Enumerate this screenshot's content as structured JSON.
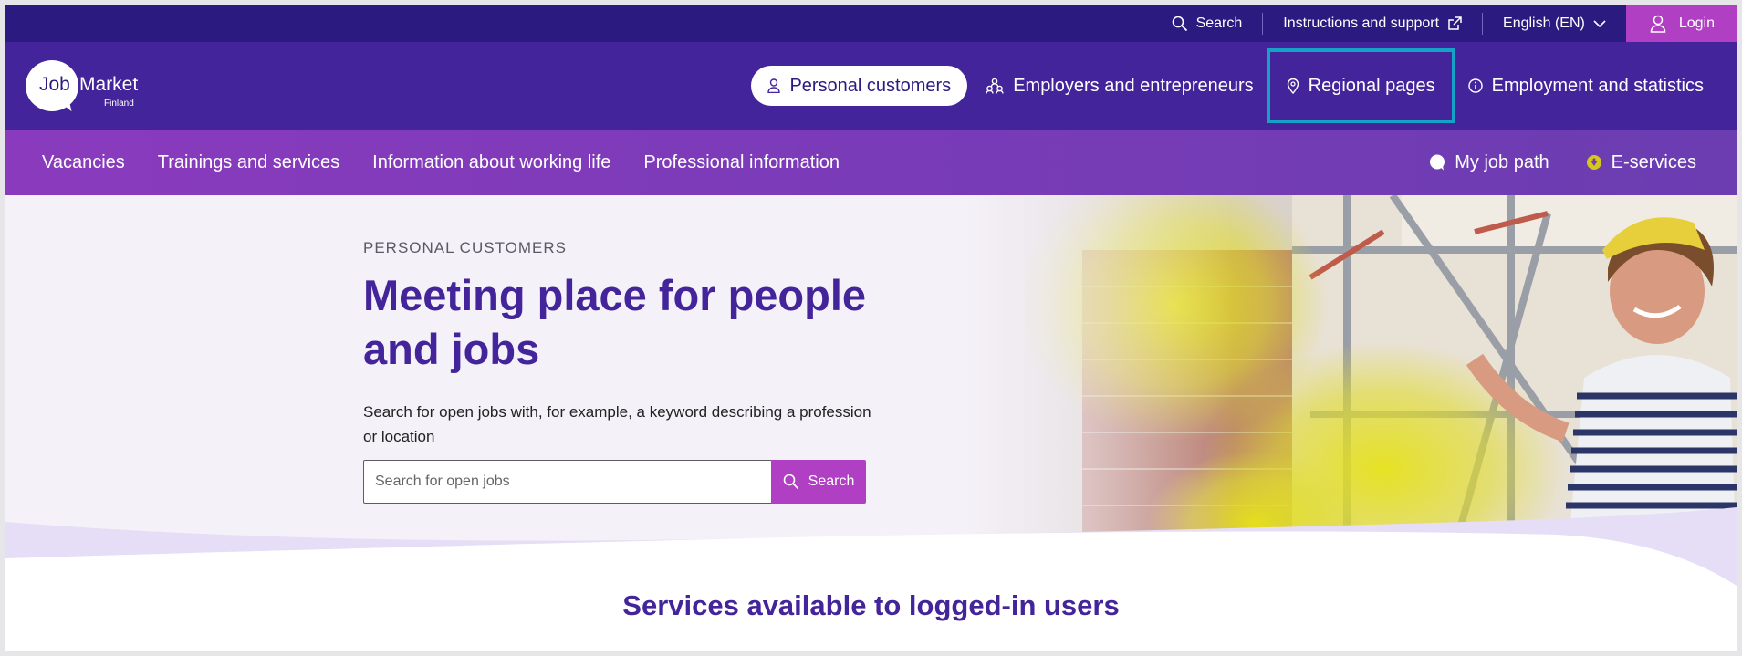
{
  "utility": {
    "search_label": "Search",
    "support_label": "Instructions and support",
    "language_label": "English (EN)",
    "login_label": "Login"
  },
  "logo": {
    "job": "Job",
    "market": "Market",
    "finland": "Finland"
  },
  "audience_nav": [
    {
      "label": "Personal customers",
      "icon": "person-icon",
      "active": true
    },
    {
      "label": "Employers and entrepreneurs",
      "icon": "people-group-icon"
    },
    {
      "label": "Regional pages",
      "icon": "location-pin-icon",
      "focused": true
    },
    {
      "label": "Employment and statistics",
      "icon": "info-icon"
    }
  ],
  "secondary_nav": {
    "left": [
      "Vacancies",
      "Trainings and services",
      "Information about working life",
      "Professional information"
    ],
    "my_job_path": "My job path",
    "eservices": "E-services"
  },
  "hero": {
    "eyebrow": "PERSONAL CUSTOMERS",
    "title": "Meeting place for people and jobs",
    "description": "Search for open jobs with, for example, a keyword describing a profession or location",
    "search_placeholder": "Search for open jobs",
    "search_button": "Search"
  },
  "services_title": "Services available to logged-in users",
  "colors": {
    "utility_bar": "#2b1b81",
    "header": "#43249a",
    "accent": "#b13fc3",
    "focus_ring": "#16a2c7",
    "secondary_nav": "#7a3bb8"
  }
}
